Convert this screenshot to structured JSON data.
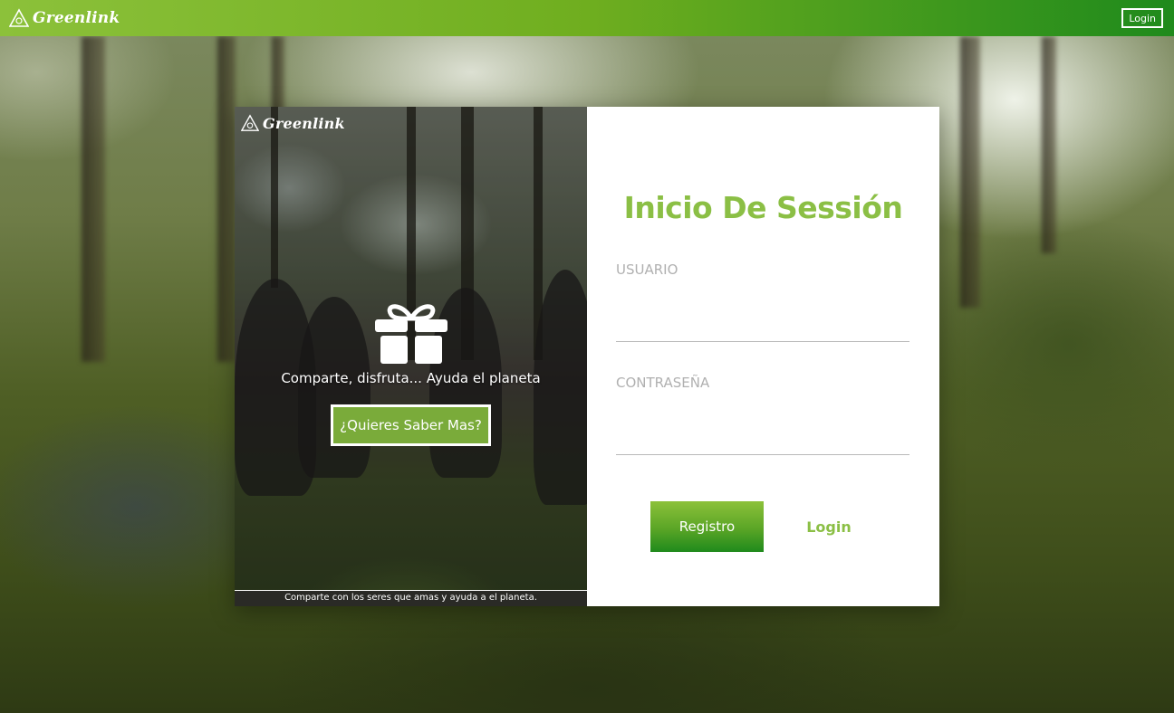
{
  "topbar": {
    "brand": "Greenlink",
    "login_label": "Login"
  },
  "card_left": {
    "brand": "Greenlink",
    "tagline": "Comparte, disfruta... Ayuda el planeta",
    "more_button_label": "¿Quieres Saber Mas?",
    "footer_text": "Comparte con los seres que amas y ayuda a el planeta.",
    "icon": "gift-icon"
  },
  "login_form": {
    "title": "Inicio De Sessión",
    "username_label": "USUARIO",
    "username_value": "",
    "password_label": "CONTRASEÑA",
    "password_value": "",
    "register_label": "Registro",
    "login_label": "Login"
  },
  "colors": {
    "accent_green": "#8bbf45",
    "button_green_top": "#8cc13a",
    "button_green_bottom": "#1f8a1c"
  }
}
